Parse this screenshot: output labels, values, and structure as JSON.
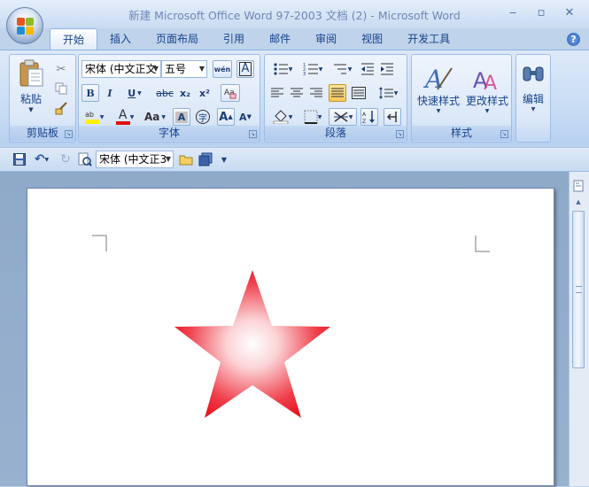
{
  "window": {
    "title": "新建 Microsoft Office Word 97-2003 文档 (2) - Microsoft Word",
    "minimize_glyph": "‒",
    "maximize_glyph": "▫",
    "close_glyph": "✕"
  },
  "tabs": [
    {
      "label": "开始",
      "active": true
    },
    {
      "label": "插入"
    },
    {
      "label": "页面布局"
    },
    {
      "label": "引用"
    },
    {
      "label": "邮件"
    },
    {
      "label": "审阅"
    },
    {
      "label": "视图"
    },
    {
      "label": "开发工具"
    }
  ],
  "help_glyph": "?",
  "ribbon": {
    "clipboard": {
      "label": "剪贴板",
      "paste_label": "粘贴"
    },
    "font": {
      "label": "字体",
      "font_name": "宋体 (中文正文",
      "font_size": "五号",
      "bold": "B",
      "italic": "I",
      "underline": "U",
      "strike": "abc",
      "subscript": "x₂",
      "superscript": "x²",
      "aa": "Aa",
      "grow": "A",
      "shrink": "A",
      "char_border": "A",
      "enclose": "字",
      "wen": "wén",
      "font_color_glyph": "A",
      "char_shading": "A"
    },
    "paragraph": {
      "label": "段落"
    },
    "styles": {
      "label": "样式",
      "quick_styles": "快速样式",
      "change_styles": "更改样式"
    },
    "editing": {
      "label": "编辑"
    }
  },
  "qat": {
    "font_name": "宋体 (中文正3"
  },
  "document": {
    "shape": "star",
    "star_colors": {
      "center": "#ffffff",
      "edge": "#ee1c25"
    }
  },
  "colors": {
    "accent": "#15428b",
    "ribbon_bg": "#c5dbf4",
    "doc_bg": "#8fa9c9"
  }
}
